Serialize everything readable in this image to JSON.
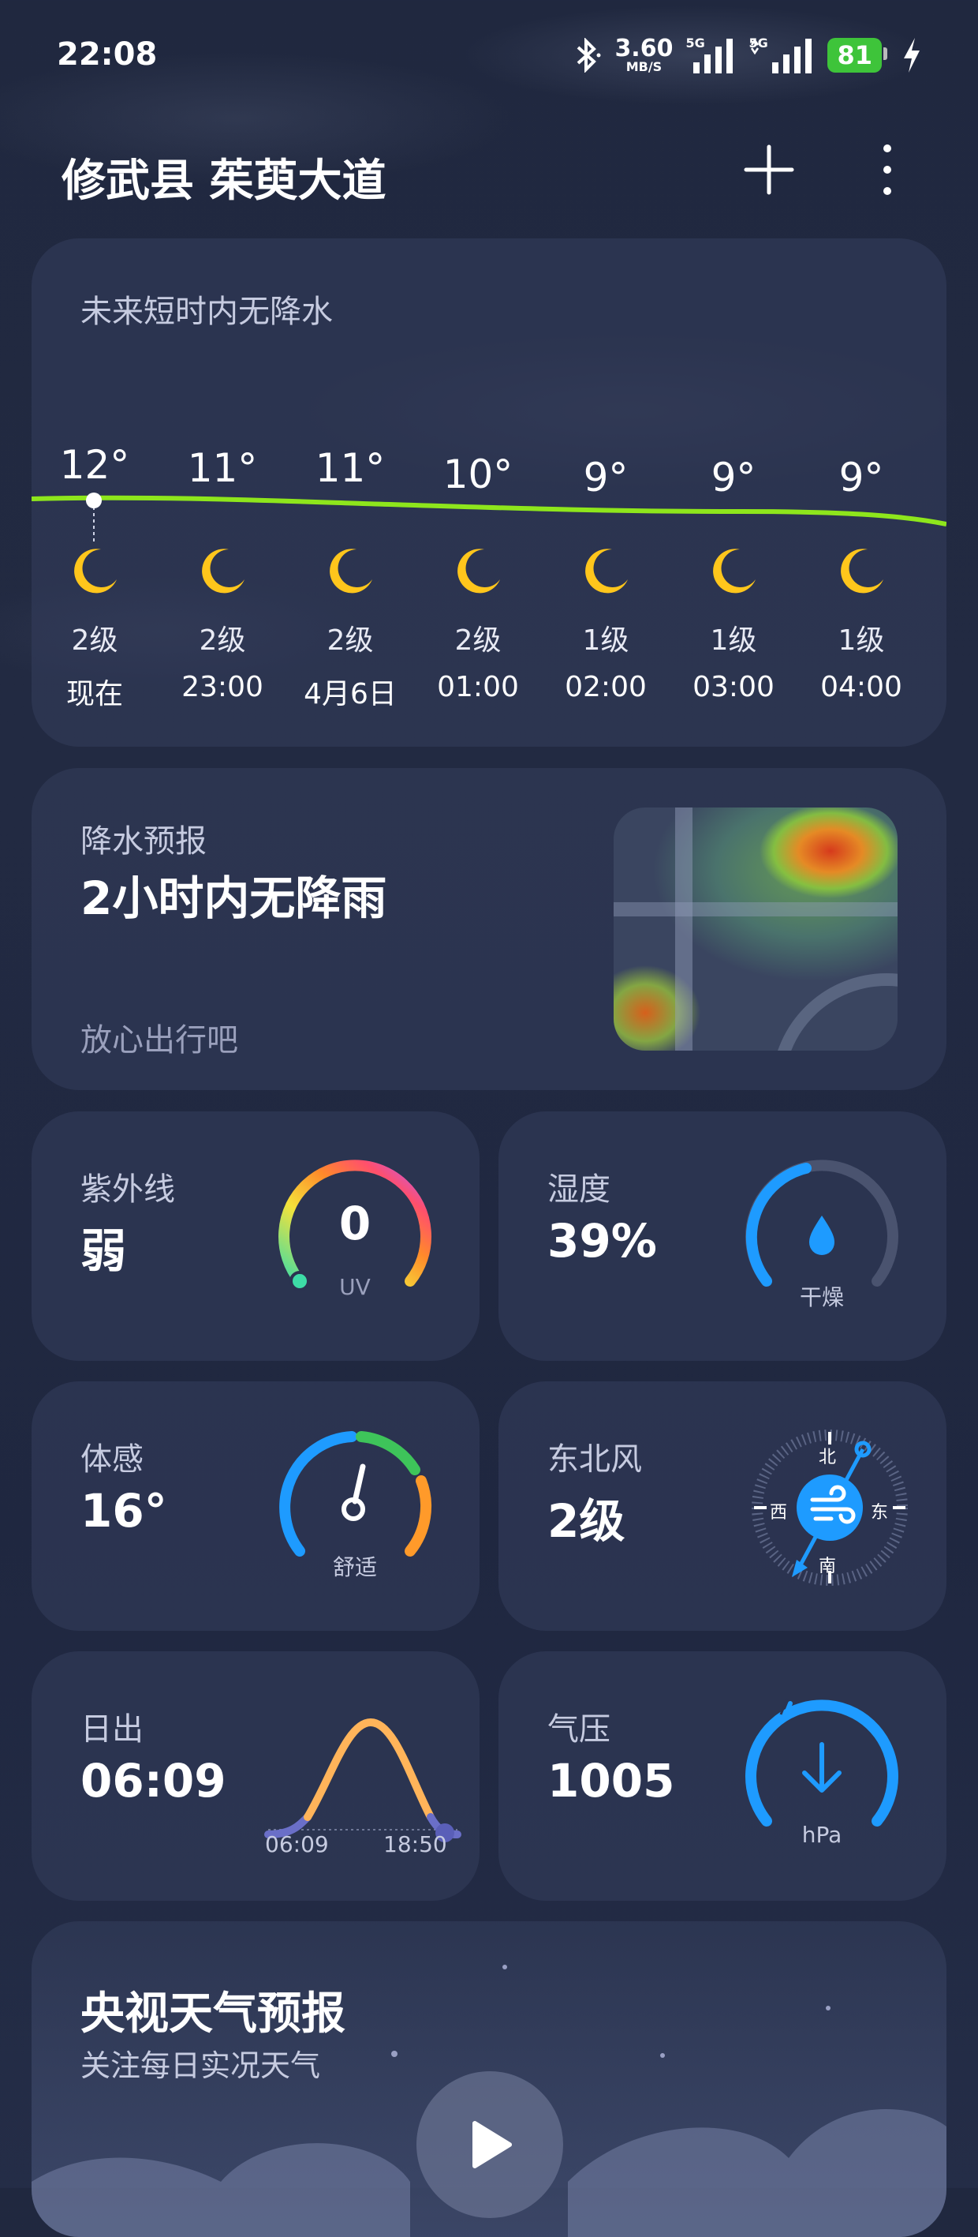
{
  "status_bar": {
    "time": "22:08",
    "net_speed": "3.60",
    "net_unit": "MB/S",
    "sig1": "5G",
    "sig2": "5G",
    "battery": "81"
  },
  "header": {
    "location": "修武县 茱萸大道"
  },
  "hourly": {
    "tip": "未来短时内无降水",
    "items": [
      {
        "temp": "12°",
        "wind": "2级",
        "time": "现在"
      },
      {
        "temp": "11°",
        "wind": "2级",
        "time": "23:00"
      },
      {
        "temp": "11°",
        "wind": "2级",
        "time": "4月6日"
      },
      {
        "temp": "10°",
        "wind": "2级",
        "time": "01:00"
      },
      {
        "temp": "9°",
        "wind": "1级",
        "time": "02:00"
      },
      {
        "temp": "9°",
        "wind": "1级",
        "time": "03:00"
      },
      {
        "temp": "9°",
        "wind": "1级",
        "time": "04:00"
      }
    ],
    "line_color": "#8ee61c"
  },
  "precip": {
    "label": "降水预报",
    "main": "2小时内无降雨",
    "sub": "放心出行吧"
  },
  "uv": {
    "label": "紫外线",
    "value": "弱",
    "index": "0",
    "unit": "UV"
  },
  "humidity": {
    "label": "湿度",
    "value": "39%",
    "desc": "干燥",
    "fraction": 0.39
  },
  "feels_like": {
    "label": "体感",
    "value": "16°",
    "desc": "舒适"
  },
  "wind": {
    "label": "东北风",
    "value": "2级",
    "north": "北",
    "south": "南",
    "east": "东",
    "west": "西"
  },
  "sunrise": {
    "label": "日出",
    "value": "06:09",
    "rise": "06:09",
    "set": "18:50"
  },
  "pressure": {
    "label": "气压",
    "value": "1005",
    "unit": "hPa"
  },
  "video": {
    "title": "央视天气预报",
    "sub": "关注每日实况天气"
  }
}
